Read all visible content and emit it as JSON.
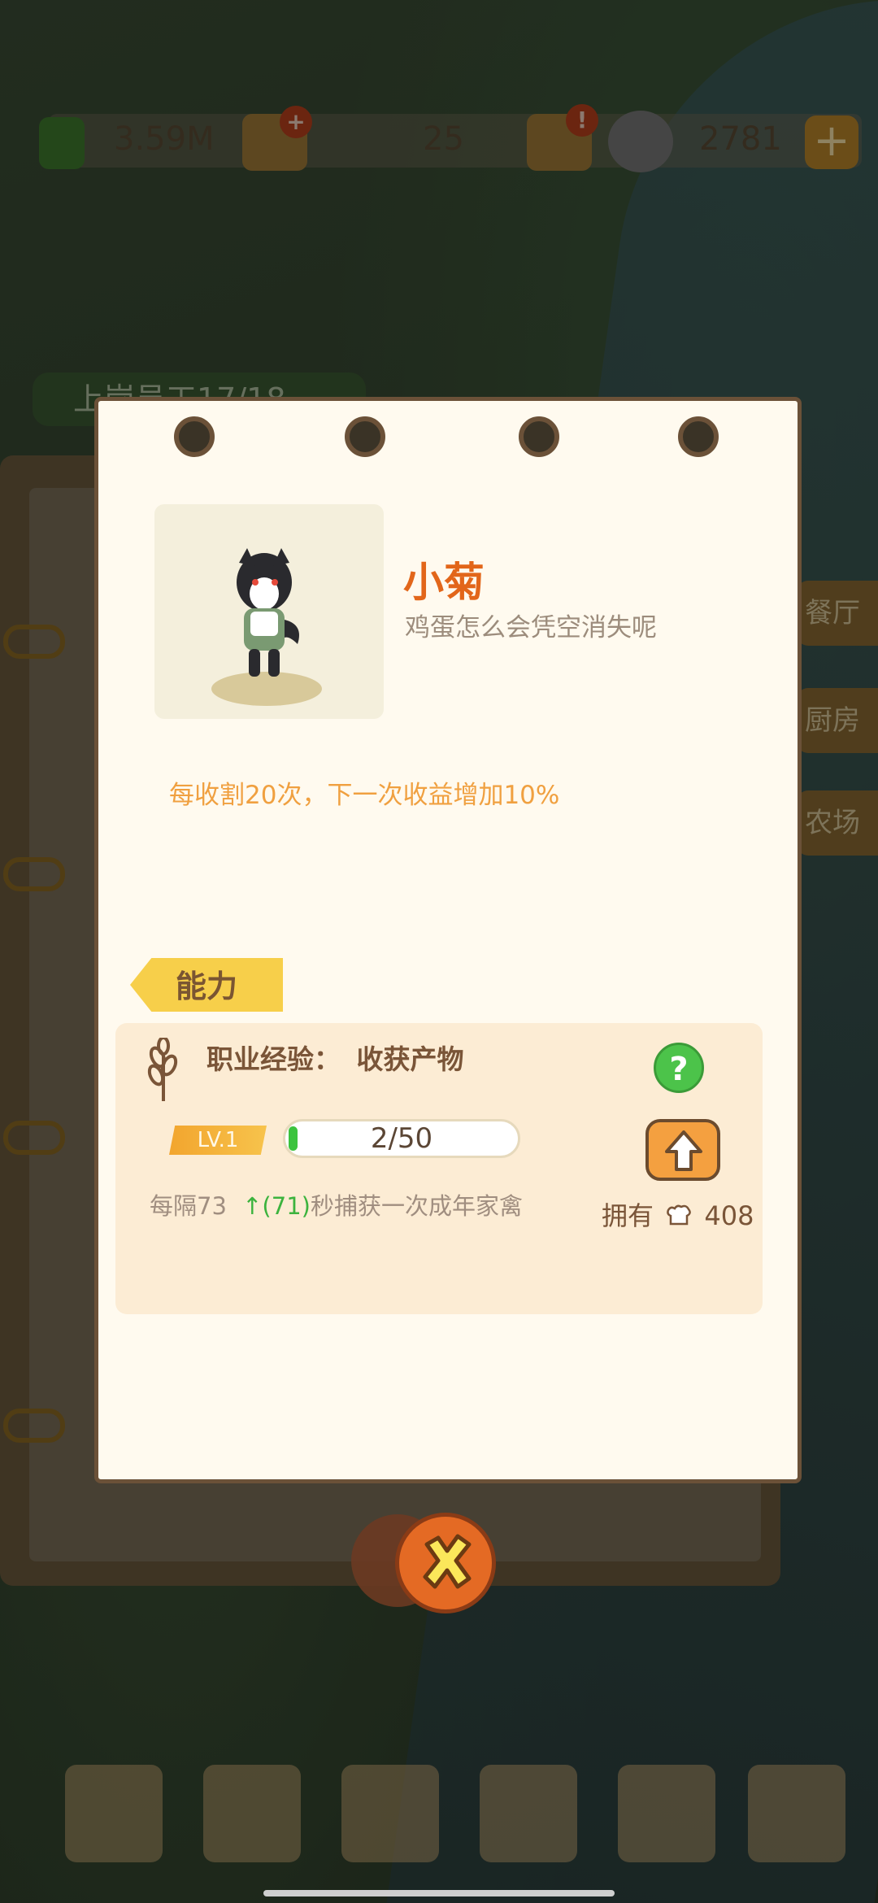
{
  "resources": {
    "money": "3.59M",
    "items": "25",
    "pandas": "2781",
    "badge_alert": "!",
    "badge_plus": "+"
  },
  "background": {
    "staff_tag": "上岗员工17/18",
    "side_tabs": [
      "餐厅",
      "厨房",
      "农场"
    ]
  },
  "character": {
    "name": "小菊",
    "description": "鸡蛋怎么会凭空消失呢",
    "skill": "每收割20次，下一次收益增加10%"
  },
  "ability": {
    "tab_label": "能力",
    "job_label": "职业经验：",
    "job_value": "收获产物",
    "help": "?",
    "level": "LV.1",
    "xp_text": "2/50",
    "xp_progress": 0.04,
    "interval_prefix": "每隔73",
    "interval_up": "↑(71)",
    "interval_suffix": "秒捕获一次成年家禽",
    "own_label": "拥有",
    "own_value": "408"
  },
  "colors": {
    "accent_orange": "#e2661a",
    "progress_green": "#3cc33e",
    "card_bg": "#fffaef"
  },
  "icons": [
    "wheat-icon",
    "help-icon",
    "upgrade-arrow-icon",
    "close-icon",
    "chef-hat-icon",
    "panda-icon"
  ]
}
